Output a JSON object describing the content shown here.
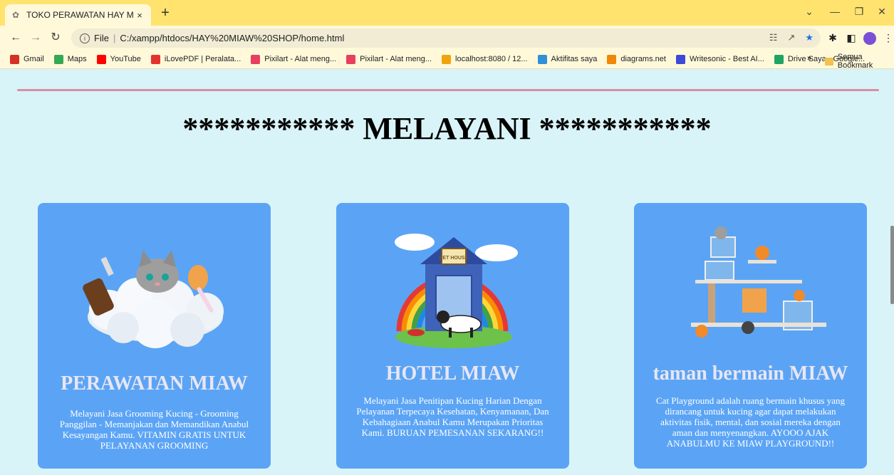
{
  "browser": {
    "tab_title": "TOKO PERAWATAN HAY MIAW...",
    "tab_close": "×",
    "new_tab": "+",
    "url_scheme": "File",
    "url": "C:/xampp/htdocs/HAY%20MIAW%20SHOP/home.html",
    "bookmarks": [
      {
        "label": "Gmail",
        "color": "#d93025"
      },
      {
        "label": "Maps",
        "color": "#34a853"
      },
      {
        "label": "YouTube",
        "color": "#ff0000"
      },
      {
        "label": "iLovePDF | Peralata...",
        "color": "#e5322d"
      },
      {
        "label": "Pixilart - Alat meng...",
        "color": "#e83e5f"
      },
      {
        "label": "Pixilart - Alat meng...",
        "color": "#e83e5f"
      },
      {
        "label": "localhost:8080 / 12...",
        "color": "#f0a30a"
      },
      {
        "label": "Aktifitas saya",
        "color": "#2f8fd8"
      },
      {
        "label": "diagrams.net",
        "color": "#f08705"
      },
      {
        "label": "Writesonic - Best AI...",
        "color": "#3c4ad8"
      },
      {
        "label": "Drive Saya - Google...",
        "color": "#1fa463"
      }
    ],
    "bookmarks_more": "»",
    "bookmarks_folder": "Semua Bookmark"
  },
  "page": {
    "heading": "*********** MELAYANI ***********",
    "cards": [
      {
        "title": "PERAWATAN MIAW",
        "description": "Melayani Jasa Grooming Kucing - Grooming Panggilan - Memanjakan dan Memandikan Anabul Kesayangan Kamu. VITAMIN GRATIS UNTUK PELAYANAN GROOMING"
      },
      {
        "title": "HOTEL MIAW",
        "description": "Melayani Jasa Penitipan Kucing Harian Dengan Pelayanan Terpecaya Kesehatan, Kenyamanan, Dan Kebahagiaan Anabul Kamu Merupakan Prioritas Kami. BURUAN PEMESANAN SEKARANG!!"
      },
      {
        "title": "taman bermain MIAW",
        "description": "Cat Playground adalah ruang bermain khusus yang dirancang untuk kucing agar dapat melakukan aktivitas fisik, mental, dan sosial mereka dengan aman dan menyenangkan. AYOOO AJAK ANABULMU KE MIAW PLAYGROUND!!"
      }
    ],
    "hotel_sign": "PET HOUSE"
  },
  "colors": {
    "tab_strip": "#ffe36e",
    "toolbar": "#fff9da",
    "page_bg": "#d9f4f8",
    "card_bg": "#5ba4f5",
    "divider": "#d58fa8"
  }
}
